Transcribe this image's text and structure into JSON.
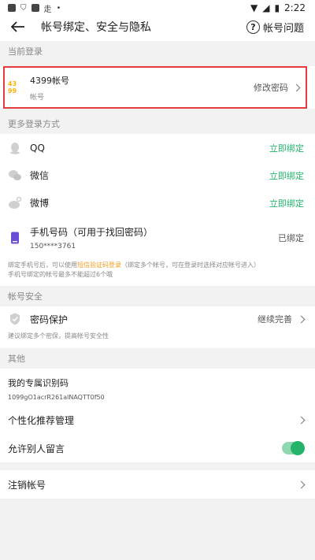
{
  "status_bar": {
    "time": "2:22",
    "left_glyph": "走"
  },
  "header": {
    "title": "帐号绑定、安全与隐私",
    "help_label": "帐号问题",
    "help_icon_glyph": "?"
  },
  "current_login": {
    "section_title": "当前登录",
    "account_name": "4399帐号",
    "account_sub": "帐号",
    "change_password": "修改密码",
    "logo_top": "43",
    "logo_bottom": "99"
  },
  "more_login": {
    "section_title": "更多登录方式",
    "items": [
      {
        "label": "QQ",
        "action": "立即绑定",
        "icon": "qq-icon"
      },
      {
        "label": "微信",
        "action": "立即绑定",
        "icon": "wechat-icon"
      },
      {
        "label": "微博",
        "action": "立即绑定",
        "icon": "weibo-icon"
      }
    ],
    "phone": {
      "label": "手机号码（可用于找回密码）",
      "number": "150****3761",
      "status": "已绑定",
      "note_part1": "绑定手机号后，可以使用",
      "note_link": "短信验证码登录",
      "note_part2": "（绑定多个帐号，可在登录时选择对应帐号进入）",
      "note_line2": "手机号绑定的帐号最多不能超过6个哦"
    }
  },
  "account_security": {
    "section_title": "帐号安全",
    "password_protect_label": "密码保护",
    "password_protect_action": "继续完善",
    "note": "建议绑定多个密保，提高帐号安全性"
  },
  "other": {
    "section_title": "其他",
    "id_title": "我的专属识别码",
    "id_code": "1099gO1acrR261alNAQTT0f50",
    "recommend_label": "个性化推荐管理",
    "allow_comment_label": "允许别人留言",
    "allow_comment_on": true,
    "cancel_account_label": "注销帐号"
  },
  "colors": {
    "accent_green": "#23b36a",
    "highlight_red": "#e53d3d",
    "link_orange": "#f29c1f"
  }
}
